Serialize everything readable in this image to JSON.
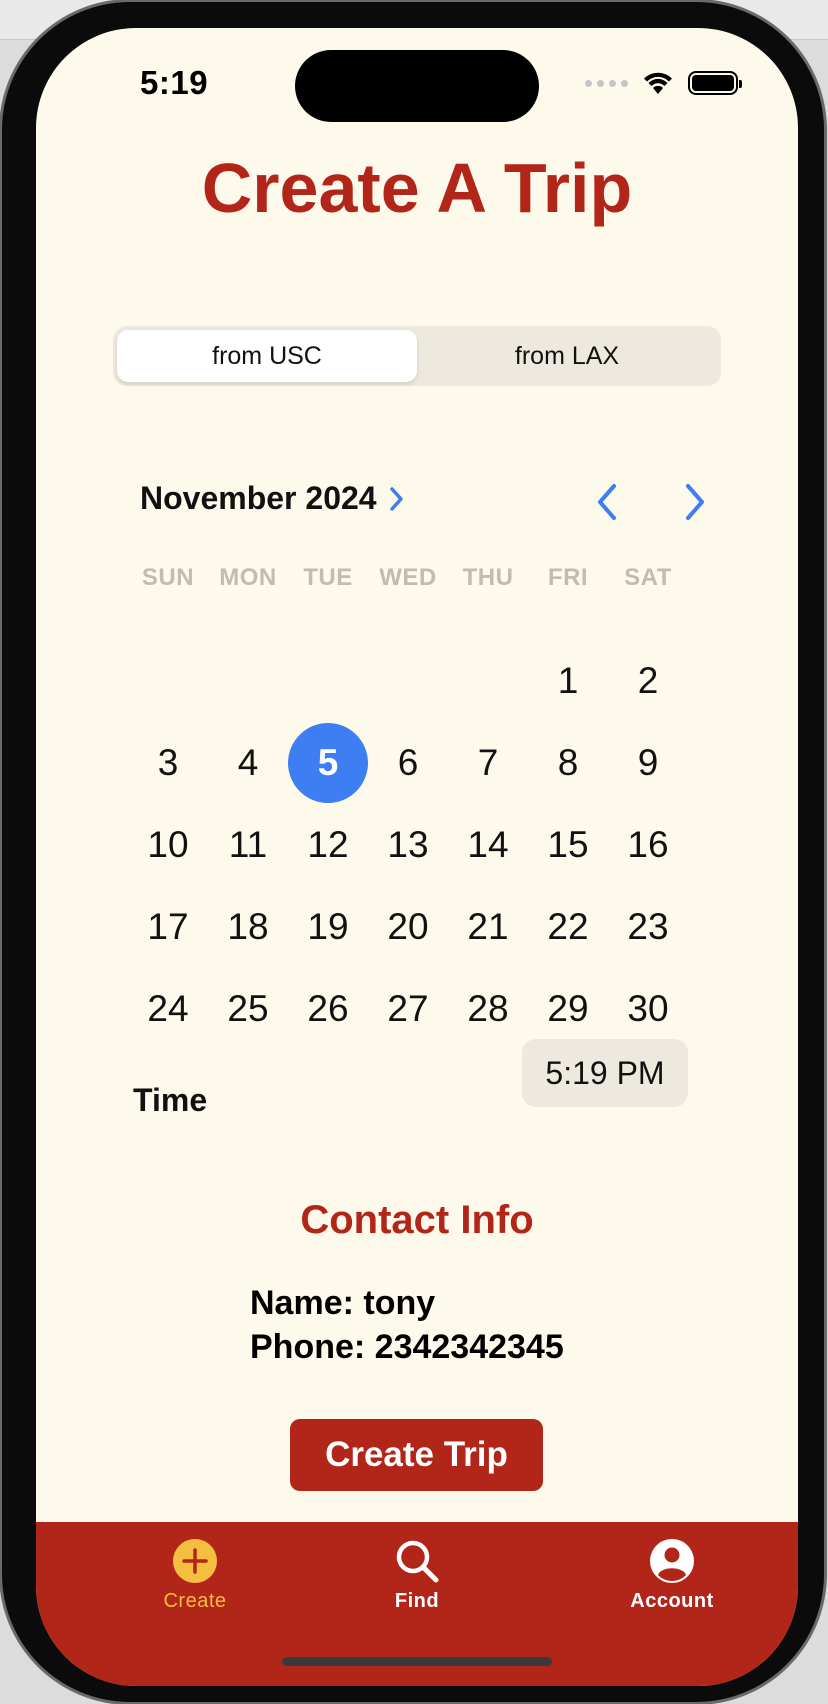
{
  "status_bar": {
    "time": "5:19"
  },
  "page": {
    "title": "Create A Trip"
  },
  "route_selector": {
    "options": [
      "from USC",
      "from LAX"
    ],
    "selected": "from USC"
  },
  "calendar": {
    "month_label": "November 2024",
    "weekdays": [
      "SUN",
      "MON",
      "TUE",
      "WED",
      "THU",
      "FRI",
      "SAT"
    ],
    "days": [
      "",
      "",
      "",
      "",
      "",
      "1",
      "2",
      "3",
      "4",
      "5",
      "6",
      "7",
      "8",
      "9",
      "10",
      "11",
      "12",
      "13",
      "14",
      "15",
      "16",
      "17",
      "18",
      "19",
      "20",
      "21",
      "22",
      "23",
      "24",
      "25",
      "26",
      "27",
      "28",
      "29",
      "30"
    ],
    "selected_day": "5",
    "accent_color": "#3d7ef2"
  },
  "time": {
    "label": "Time",
    "value": "5:19 PM"
  },
  "contact": {
    "title": "Contact Info",
    "name_line": "Name: tony",
    "phone_line": "Phone: 2342342345"
  },
  "actions": {
    "create_label": "Create Trip"
  },
  "tabs": [
    {
      "label": "Create",
      "icon": "plus-circle-icon",
      "active": true
    },
    {
      "label": "Find",
      "icon": "magnifier-icon",
      "active": false
    },
    {
      "label": "Account",
      "icon": "person-circle-icon",
      "active": false
    }
  ],
  "colors": {
    "brand": "#b22519",
    "background": "#fdf9eb",
    "active_tab": "#f4be3f",
    "accent": "#3d7ef2"
  }
}
